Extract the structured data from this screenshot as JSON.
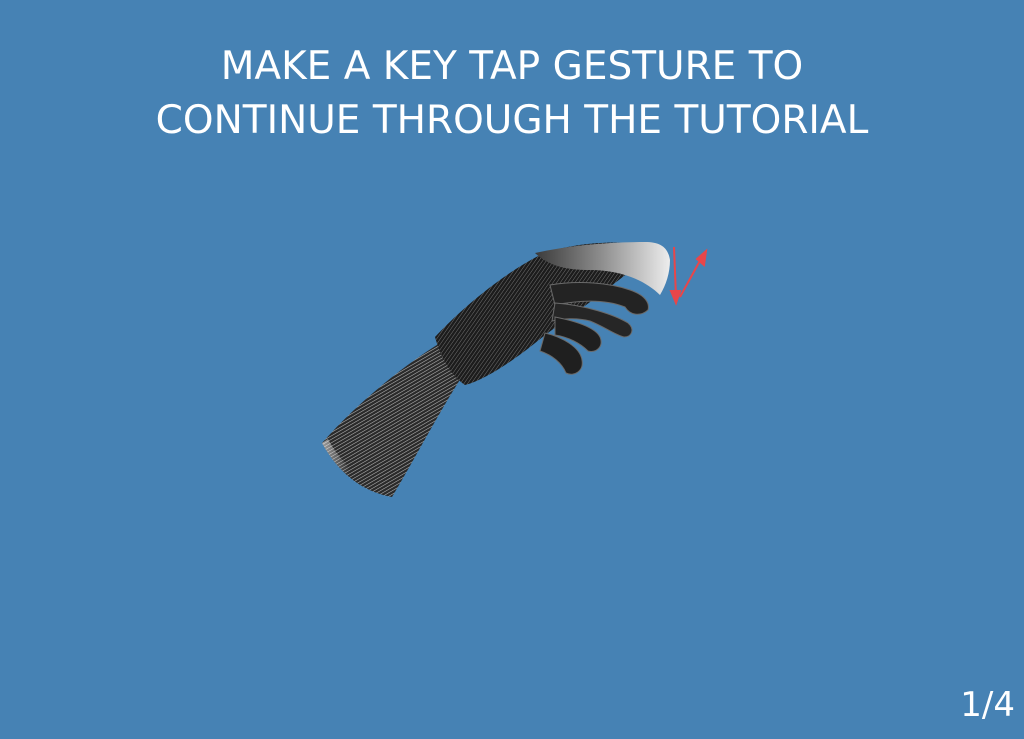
{
  "theme": {
    "background": "#4682b4",
    "text": "#ffffff",
    "arrow": "#e8464a"
  },
  "tutorial": {
    "instruction_line1": "MAKE A KEY TAP GESTURE TO",
    "instruction_line2": "CONTINUE THROUGH THE TUTORIAL",
    "illustration_icon": "hand-key-tap-icon",
    "arrows_icon": "tap-motion-arrows-icon"
  },
  "pagination": {
    "counter": "1/4"
  }
}
